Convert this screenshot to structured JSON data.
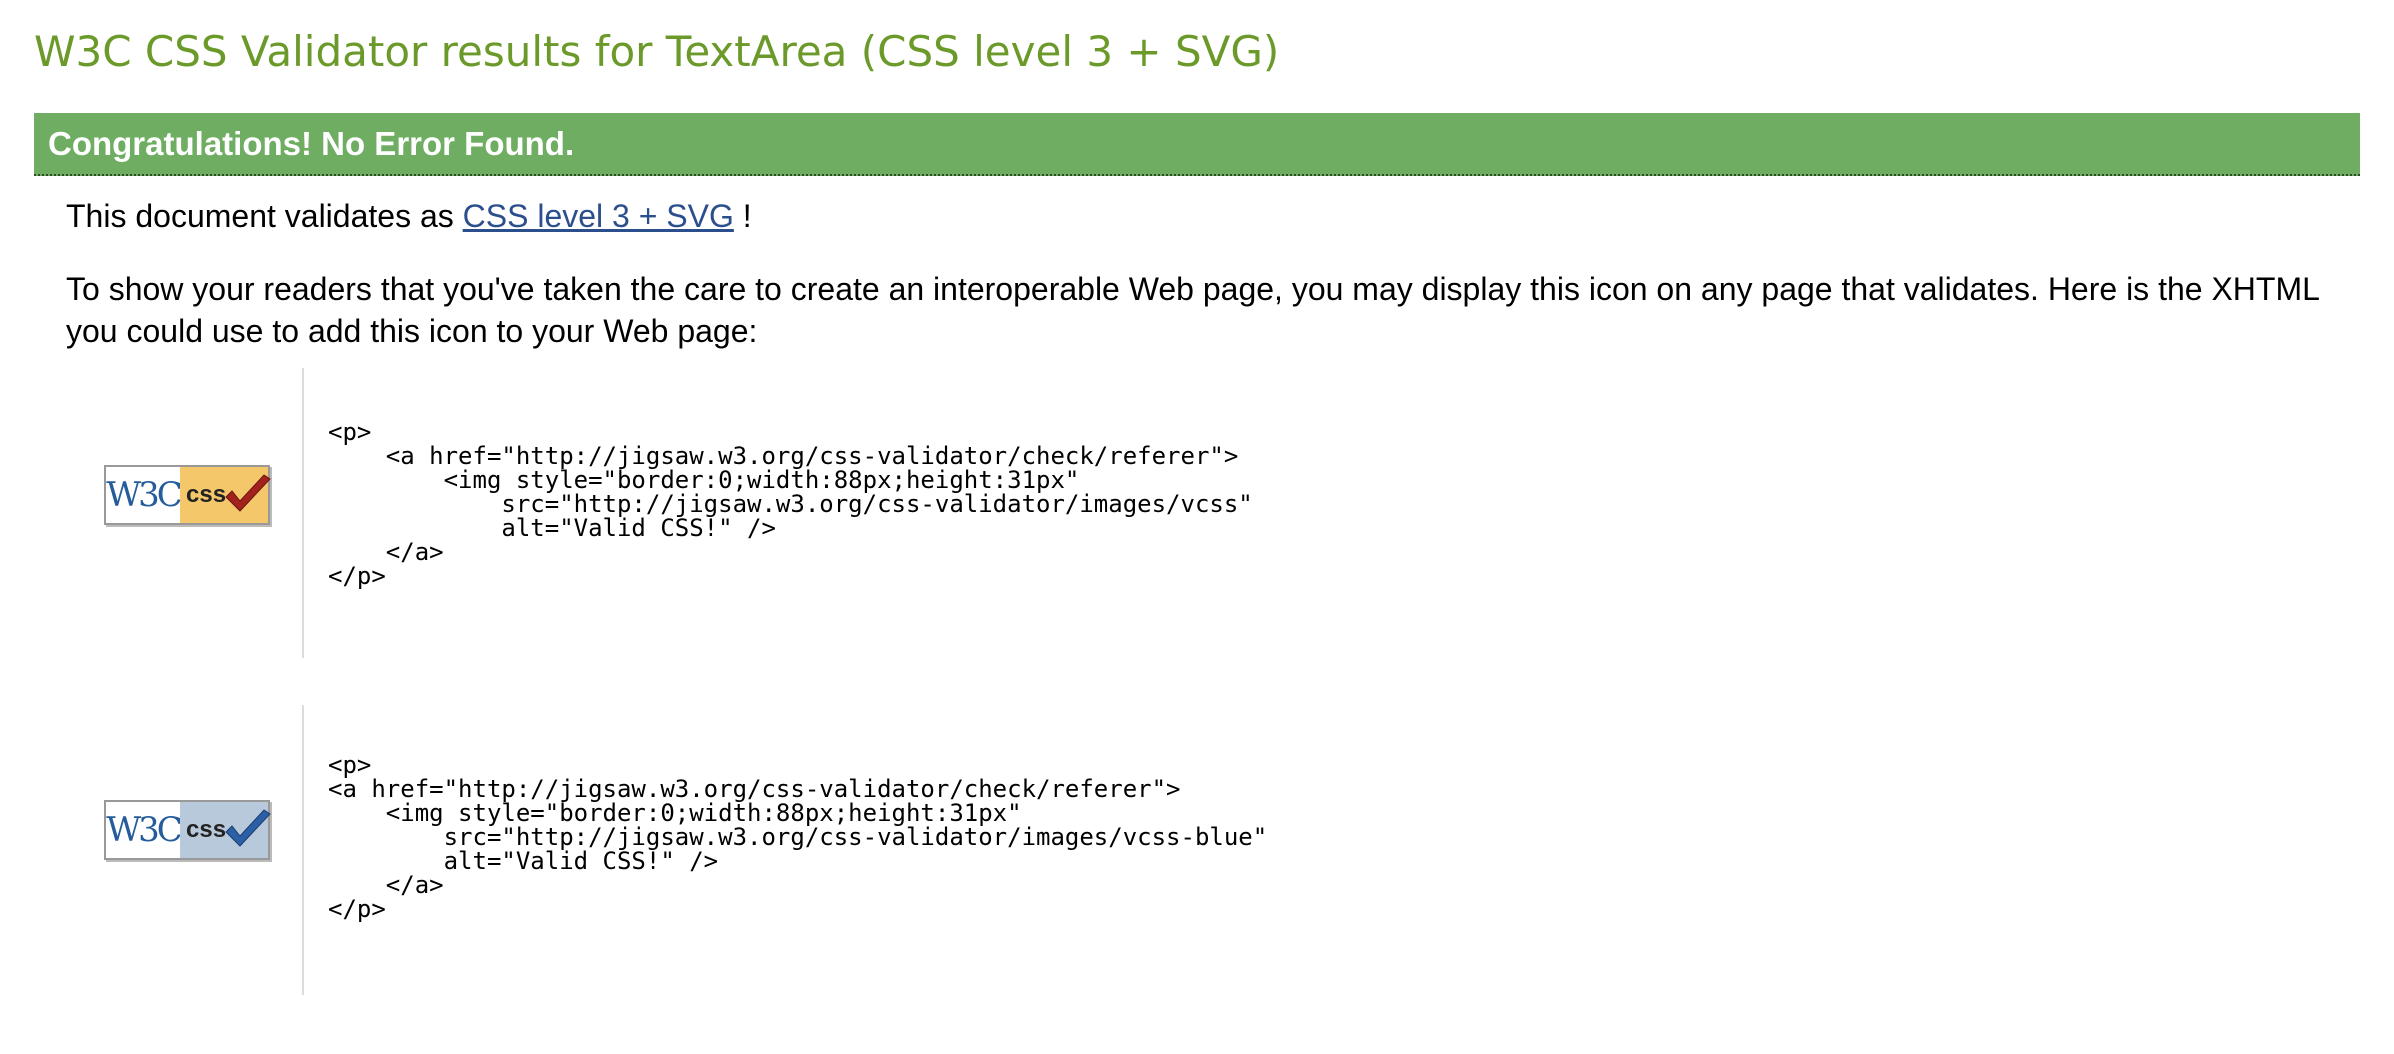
{
  "page": {
    "title": "W3C CSS Validator results for TextArea (CSS level 3 + SVG)"
  },
  "banner": {
    "text": "Congratulations! No Error Found.",
    "color": "#6fae62"
  },
  "validates": {
    "prefix": "This document validates as",
    "link_text": "CSS level 3 + SVG",
    "suffix": " !"
  },
  "info_paragraph": "To show your readers that you've taken the care to create an interoperable Web page, you may display this icon on any page that validates. Here is the XHTML you could use to add this icon to your Web page:",
  "icons": [
    {
      "badge_left": "W3C",
      "badge_right": "css",
      "badge_color": "gold",
      "check_color": "#a3221c",
      "code": "<p>\n    <a href=\"http://jigsaw.w3.org/css-validator/check/referer\">\n        <img style=\"border:0;width:88px;height:31px\"\n            src=\"http://jigsaw.w3.org/css-validator/images/vcss\"\n            alt=\"Valid CSS!\" />\n    </a>\n</p>"
    },
    {
      "badge_left": "W3C",
      "badge_right": "css",
      "badge_color": "blue",
      "check_color": "#2b5fa6",
      "code": "<p>\n<a href=\"http://jigsaw.w3.org/css-validator/check/referer\">\n    <img style=\"border:0;width:88px;height:31px\"\n        src=\"http://jigsaw.w3.org/css-validator/images/vcss-blue\"\n        alt=\"Valid CSS!\" />\n    </a>\n</p>"
    }
  ]
}
